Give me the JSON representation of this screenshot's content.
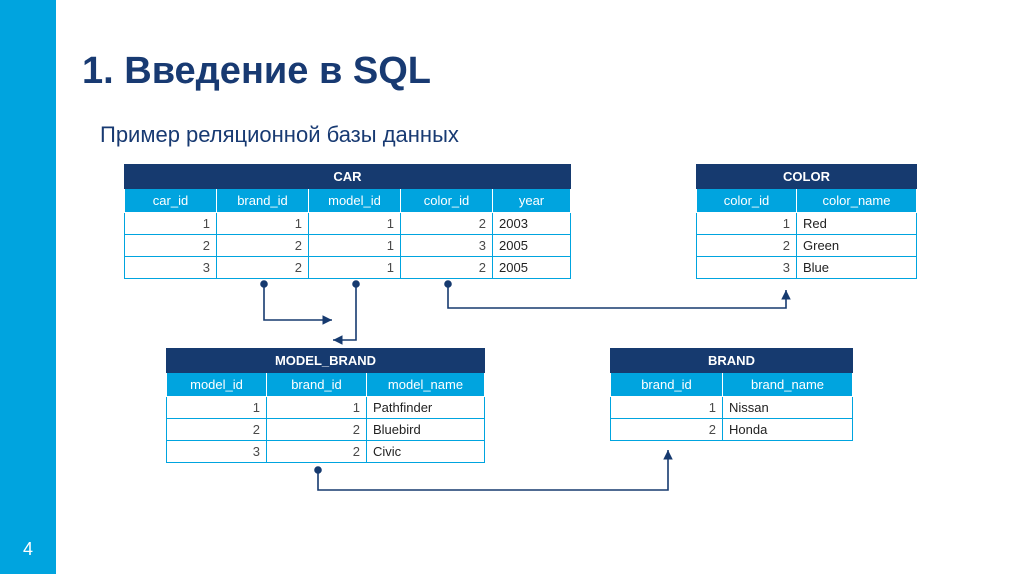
{
  "page_number": "4",
  "title": "1. Введение в SQL",
  "subtitle": "Пример реляционной базы данных",
  "tables": {
    "car": {
      "name": "CAR",
      "columns": [
        "car_id",
        "brand_id",
        "model_id",
        "color_id",
        "year"
      ],
      "rows": [
        {
          "car_id": "1",
          "brand_id": "1",
          "model_id": "1",
          "color_id": "2",
          "year": "2003"
        },
        {
          "car_id": "2",
          "brand_id": "2",
          "model_id": "1",
          "color_id": "3",
          "year": "2005"
        },
        {
          "car_id": "3",
          "brand_id": "2",
          "model_id": "1",
          "color_id": "2",
          "year": "2005"
        }
      ]
    },
    "color": {
      "name": "COLOR",
      "columns": [
        "color_id",
        "color_name"
      ],
      "rows": [
        {
          "color_id": "1",
          "color_name": "Red"
        },
        {
          "color_id": "2",
          "color_name": "Green"
        },
        {
          "color_id": "3",
          "color_name": "Blue"
        }
      ]
    },
    "model_brand": {
      "name": "MODEL_BRAND",
      "columns": [
        "model_id",
        "brand_id",
        "model_name"
      ],
      "rows": [
        {
          "model_id": "1",
          "brand_id": "1",
          "model_name": "Pathfinder"
        },
        {
          "model_id": "2",
          "brand_id": "2",
          "model_name": "Bluebird"
        },
        {
          "model_id": "3",
          "brand_id": "2",
          "model_name": "Civic"
        }
      ]
    },
    "brand": {
      "name": "BRAND",
      "columns": [
        "brand_id",
        "brand_name"
      ],
      "rows": [
        {
          "brand_id": "1",
          "brand_name": "Nissan"
        },
        {
          "brand_id": "2",
          "brand_name": "Honda"
        }
      ]
    }
  }
}
